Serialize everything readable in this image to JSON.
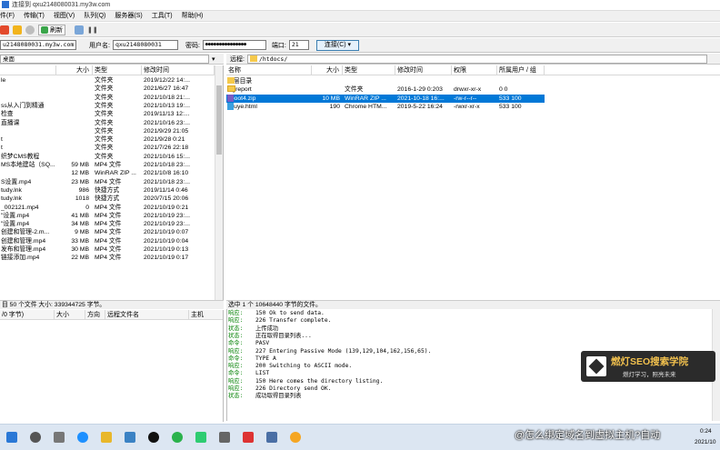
{
  "window": {
    "title": "连接到 qxu2148080031.my3w.com"
  },
  "menu": [
    "件(F)",
    "传输(T)",
    "视图(V)",
    "队列(Q)",
    "服务器(S)",
    "工具(T)",
    "帮助(H)"
  ],
  "toolbar": {
    "refresh_label": "刷新"
  },
  "connection": {
    "host_value": "u2148080031.my3w.com",
    "user_label": "用户名:",
    "user_value": "qxu2148080031",
    "pass_label": "密码:",
    "pass_value": "●●●●●●●●●●●●●●●",
    "port_label": "端口:",
    "port_value": "21",
    "connect_label": "连接(C)"
  },
  "local": {
    "path": "桌面",
    "headers": [
      "",
      "大小",
      "类型",
      "修改时间"
    ],
    "rows": [
      {
        "name": "le",
        "size": "",
        "type": "文件夹",
        "date": "2019/12/22 14:..."
      },
      {
        "name": "",
        "size": "",
        "type": "文件夹",
        "date": "2021/6/27 16:47"
      },
      {
        "name": "",
        "size": "",
        "type": "文件夹",
        "date": "2021/10/18 21:..."
      },
      {
        "name": "ss从入门到精通",
        "size": "",
        "type": "文件夹",
        "date": "2021/10/13 19:..."
      },
      {
        "name": "检查",
        "size": "",
        "type": "文件夹",
        "date": "2019/11/13 12:..."
      },
      {
        "name": "直播课",
        "size": "",
        "type": "文件夹",
        "date": "2021/10/16 23:..."
      },
      {
        "name": "",
        "size": "",
        "type": "文件夹",
        "date": "2021/9/29 21:05"
      },
      {
        "name": "t",
        "size": "",
        "type": "文件夹",
        "date": "2021/9/28 0:21"
      },
      {
        "name": "t",
        "size": "",
        "type": "文件夹",
        "date": "2021/7/26 22:18"
      },
      {
        "name": "织梦CMS教程",
        "size": "",
        "type": "文件夹",
        "date": "2021/10/16 15:..."
      },
      {
        "name": "MS本地建站（SQ...",
        "size": "59 MB",
        "type": "MP4 文件",
        "date": "2021/10/18 23:..."
      },
      {
        "name": "",
        "size": "12 MB",
        "type": "WinRAR ZIP ...",
        "date": "2021/10/8 16:10"
      },
      {
        "name": "S设置.mp4",
        "size": "23 MB",
        "type": "MP4 文件",
        "date": "2021/10/18 23:..."
      },
      {
        "name": "tudy.lnk",
        "size": "986",
        "type": "快捷方式",
        "date": "2019/11/14 0:46"
      },
      {
        "name": "tudy.lnk",
        "size": "1018",
        "type": "快捷方式",
        "date": "2020/7/15 20:06"
      },
      {
        "name": "_002121.mp4",
        "size": "0",
        "type": "MP4 文件",
        "date": "2021/10/19 0:21"
      },
      {
        "name": "\"设置.mp4",
        "size": "41 MB",
        "type": "MP4 文件",
        "date": "2021/10/19 23:..."
      },
      {
        "name": "\"设置.mp4",
        "size": "34 MB",
        "type": "MP4 文件",
        "date": "2021/10/19 23:..."
      },
      {
        "name": "创建和管理-2.m...",
        "size": "9 MB",
        "type": "MP4 文件",
        "date": "2021/10/19 0:07"
      },
      {
        "name": "创建和管理.mp4",
        "size": "33 MB",
        "type": "MP4 文件",
        "date": "2021/10/19 0:04"
      },
      {
        "name": "发布和管理.mp4",
        "size": "30 MB",
        "type": "MP4 文件",
        "date": "2021/10/19 0:13"
      },
      {
        "name": "链接添加.mp4",
        "size": "22 MB",
        "type": "MP4 文件",
        "date": "2021/10/19 0:17"
      }
    ],
    "status": "目 50 个文件 大小: 339344725 字节。"
  },
  "remote": {
    "path_label": "远程:",
    "path": "/htdocs/",
    "headers": [
      "名称",
      "大小",
      "类型",
      "修改时间",
      "权限",
      "所属用户 / 组"
    ],
    "rows": [
      {
        "name": "上层目录",
        "size": "",
        "type": "",
        "date": "",
        "perm": "",
        "owner": "",
        "icon": "up"
      },
      {
        "name": "logreport",
        "size": "",
        "type": "文件夹",
        "date": "2016-1-29 0:203",
        "perm": "drwxr-xr-x",
        "owner": "0 0",
        "icon": "folder"
      },
      {
        "name": "pboot4.zip",
        "size": "10 MB",
        "type": "WinRAR ZIP ...",
        "date": "2021-10-18 16:...",
        "perm": "-rw-r--r--",
        "owner": "533 100",
        "icon": "zip",
        "selected": true
      },
      {
        "name": "zhuye.html",
        "size": "190",
        "type": "Chrome HTM...",
        "date": "2019-5-22 16:24",
        "perm": "-rwxr-xr-x",
        "owner": "533 100",
        "icon": "html"
      }
    ],
    "status": "选中 1 个 10648440 字节的文件。"
  },
  "queue": {
    "headers": [
      "/0 字节)",
      "大小",
      "方向",
      "远程文件名",
      "主机"
    ]
  },
  "log": [
    {
      "k": "响应:",
      "v": "150 Ok to send data."
    },
    {
      "k": "响应:",
      "v": "226 Transfer complete."
    },
    {
      "k": "状态:",
      "v": "上传成功"
    },
    {
      "k": "状态:",
      "v": "正在取得目录列表..."
    },
    {
      "k": "命令:",
      "v": "PASV"
    },
    {
      "k": "响应:",
      "v": "227 Entering Passive Mode (139,129,104,162,156,65)."
    },
    {
      "k": "命令:",
      "v": "TYPE A"
    },
    {
      "k": "响应:",
      "v": "200 Switching to ASCII mode."
    },
    {
      "k": "命令:",
      "v": "LIST"
    },
    {
      "k": "响应:",
      "v": "150 Here comes the directory listing."
    },
    {
      "k": "响应:",
      "v": "226 Directory send OK."
    },
    {
      "k": "状态:",
      "v": "成功取得目录列表"
    }
  ],
  "watermark": {
    "title": "燃灯SEO搜索学院",
    "tagline": "燃灯学习，照亮未来"
  },
  "caption": "@怎么绑定域名到虚拟主机?自动",
  "clock": {
    "time": "0:24",
    "date": "2021/10"
  },
  "colors": {
    "accent": "#0078d7",
    "log_key": "#008000"
  }
}
